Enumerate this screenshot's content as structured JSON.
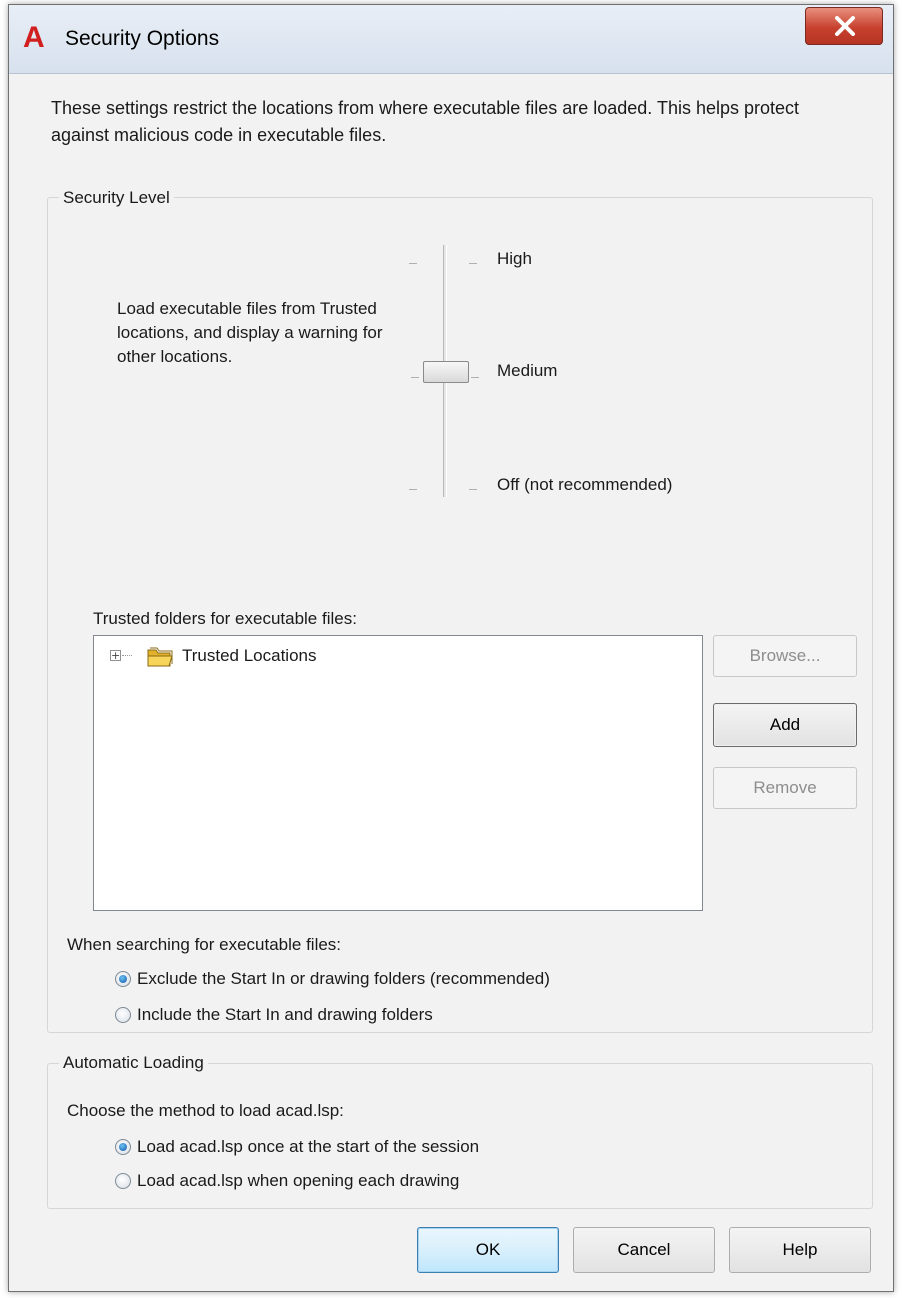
{
  "window": {
    "title": "Security Options",
    "app_icon_letter": "A"
  },
  "intro": {
    "text": "These settings restrict the locations from where executable files are loaded.  This helps protect against malicious code in executable files."
  },
  "security_level": {
    "group_title": "Security Level",
    "description": "Load executable files from Trusted locations, and display a warning for other locations.",
    "levels": [
      "High",
      "Medium",
      "Off (not recommended)"
    ],
    "selected": "Medium"
  },
  "trusted": {
    "label": "Trusted folders for executable files:",
    "tree_items": [
      {
        "label": "Trusted Locations",
        "expanded": false
      }
    ],
    "buttons": {
      "browse": "Browse...",
      "add": "Add",
      "remove": "Remove"
    }
  },
  "search": {
    "label": "When searching for executable files:",
    "options": [
      {
        "label": "Exclude the Start In or drawing folders (recommended)",
        "checked": true
      },
      {
        "label": "Include the Start In and drawing folders",
        "checked": false
      }
    ]
  },
  "auto_loading": {
    "group_title": "Automatic Loading",
    "label": "Choose the method to load acad.lsp:",
    "options": [
      {
        "label": "Load acad.lsp once at the start of the session",
        "checked": true
      },
      {
        "label": "Load acad.lsp when opening each drawing",
        "checked": false
      }
    ]
  },
  "footer": {
    "ok": "OK",
    "cancel": "Cancel",
    "help": "Help"
  },
  "colors": {
    "app_icon": "#d11f1f",
    "close_button": "#c7412e",
    "radio_selected": "#0d56a8"
  }
}
